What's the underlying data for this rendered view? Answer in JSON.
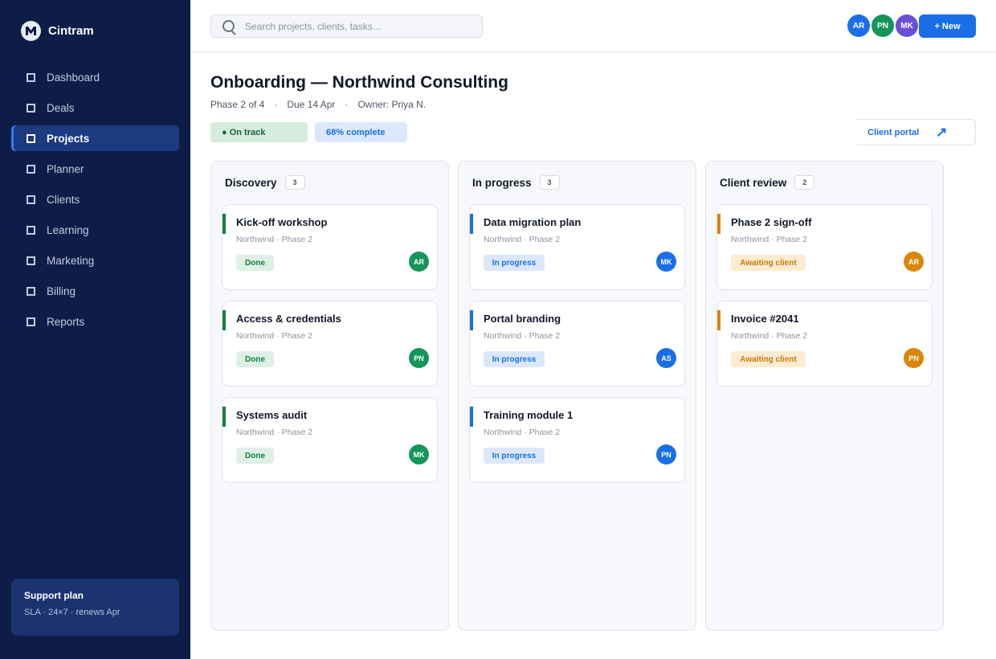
{
  "app": {
    "name": "Cintram"
  },
  "sidebar": {
    "items": [
      {
        "label": "Dashboard"
      },
      {
        "label": "Deals"
      },
      {
        "label": "Projects",
        "active": true
      },
      {
        "label": "Planner"
      },
      {
        "label": "Clients"
      },
      {
        "label": "Learning"
      },
      {
        "label": "Marketing"
      },
      {
        "label": "Billing"
      },
      {
        "label": "Reports"
      }
    ],
    "support": {
      "title": "Support plan",
      "subtitle": "SLA · 24×7 · renews Apr"
    }
  },
  "header": {
    "search": {
      "placeholder": "Search projects, clients, tasks…",
      "value": ""
    },
    "team": [
      {
        "initials": "AR",
        "color": "#1a6fe8"
      },
      {
        "initials": "PN",
        "color": "#14955a"
      },
      {
        "initials": "MK",
        "color": "#6a4fd6"
      }
    ],
    "new_label": "+ New"
  },
  "project": {
    "title": "Onboarding — Northwind Consulting",
    "phase": "Phase 2 of 4",
    "due": "Due 14 Apr",
    "owner": "Owner: Priya N.",
    "separator": "·",
    "status": "● On track",
    "progress_label": "68% complete",
    "progress": 0.68,
    "portal_label": "Client portal",
    "portal_icon": "external-arrow-icon"
  },
  "board": {
    "columns": [
      {
        "title": "Discovery",
        "count": "3",
        "cards": [
          {
            "title": "Kick-off workshop",
            "sub": "Northwind · Phase 2",
            "status": "Done",
            "assignee": "AR",
            "accent": "#15803d"
          },
          {
            "title": "Access & credentials",
            "sub": "Northwind · Phase 2",
            "status": "Done",
            "assignee": "PN",
            "accent": "#15803d"
          },
          {
            "title": "Systems audit",
            "sub": "Northwind · Phase 2",
            "status": "Done",
            "assignee": "MK",
            "accent": "#15803d"
          }
        ]
      },
      {
        "title": "In progress",
        "count": "3",
        "cards": [
          {
            "title": "Data migration plan",
            "sub": "Northwind · Phase 2",
            "status": "In progress",
            "assignee": "MK",
            "accent": "#1a6fe8"
          },
          {
            "title": "Portal branding",
            "sub": "Northwind · Phase 2",
            "status": "In progress",
            "assignee": "AS",
            "accent": "#1a6fe8"
          },
          {
            "title": "Training module 1",
            "sub": "Northwind · Phase 2",
            "status": "In progress",
            "assignee": "PN",
            "accent": "#1a6fe8"
          }
        ]
      },
      {
        "title": "Client review",
        "count": "2",
        "cards": [
          {
            "title": "Phase 2 sign-off",
            "sub": "Northwind · Phase 2",
            "status": "Awaiting client",
            "assignee": "AR",
            "accent": "#d9860a"
          },
          {
            "title": "Invoice #2041",
            "sub": "Northwind · Phase 2",
            "status": "Awaiting client",
            "assignee": "PN",
            "accent": "#d9860a"
          }
        ]
      }
    ]
  }
}
